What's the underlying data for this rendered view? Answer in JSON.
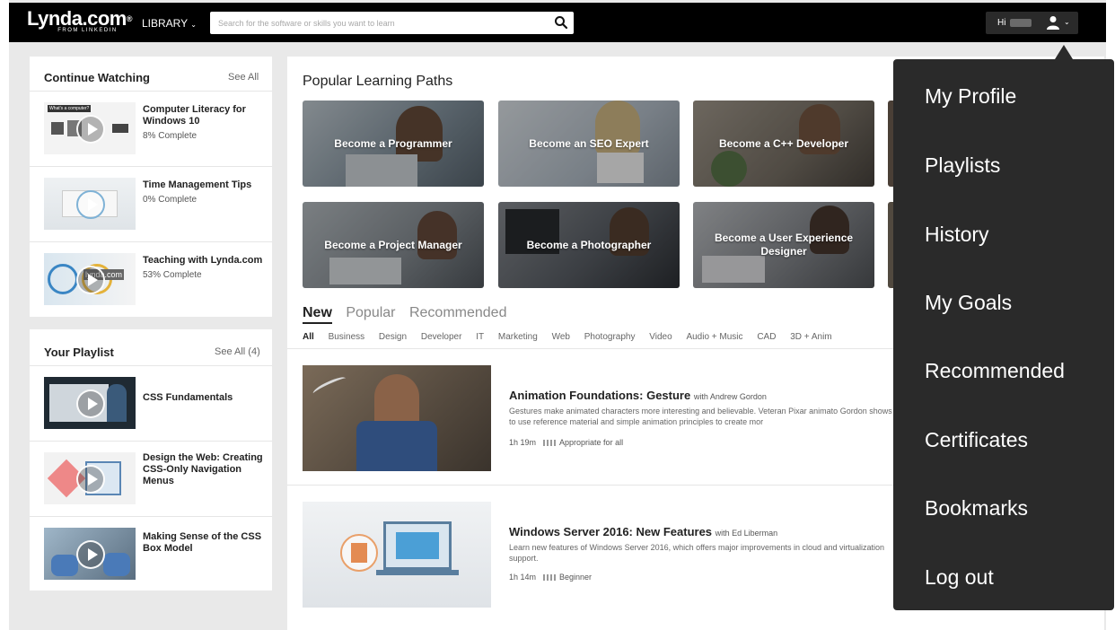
{
  "header": {
    "logo_text": "Lynda.com",
    "logo_sub": "FROM LINKEDIN",
    "library_label": "LIBRARY",
    "search_placeholder": "Search for the software or skills you want to learn",
    "greeting": "Hi"
  },
  "continue_watching": {
    "title": "Continue Watching",
    "see_all": "See All",
    "items": [
      {
        "title": "Computer Literacy for Windows 10",
        "progress": "8% Complete",
        "thumb_text": "What's a computer?"
      },
      {
        "title": "Time Management Tips",
        "progress": "0% Complete"
      },
      {
        "title": "Teaching with Lynda.com",
        "progress": "53% Complete",
        "thumb_text": "lynda.com"
      }
    ]
  },
  "playlist": {
    "title": "Your Playlist",
    "see_all": "See All (4)",
    "items": [
      {
        "title": "CSS Fundamentals"
      },
      {
        "title": "Design the Web: Creating CSS-Only Navigation Menus"
      },
      {
        "title": "Making Sense of the CSS Box Model"
      }
    ]
  },
  "learning_paths": {
    "title": "Popular Learning Paths",
    "paths": [
      {
        "label": "Become a Programmer",
        "color": "#8a9aa6"
      },
      {
        "label": "Become an SEO Expert",
        "color": "#b9c4cf"
      },
      {
        "label": "Become a C++ Developer",
        "color": "#7b7368"
      },
      {
        "label": "Become a Project Manager",
        "color": "#8d949a"
      },
      {
        "label": "Become a Photographer",
        "color": "#5c6168"
      },
      {
        "label": "Become a User Experience Designer",
        "color": "#8a8d92"
      }
    ]
  },
  "tabs": [
    "New",
    "Popular",
    "Recommended"
  ],
  "categories": [
    "All",
    "Business",
    "Design",
    "Developer",
    "IT",
    "Marketing",
    "Web",
    "Photography",
    "Video",
    "Audio + Music",
    "CAD",
    "3D + Anim"
  ],
  "courses": [
    {
      "title": "Animation Foundations: Gesture",
      "author": "with Andrew Gordon",
      "description": "Gestures make animated characters more interesting and believable. Veteran Pixar animato Gordon shows how to use reference material and simple animation principles to create mor",
      "duration": "1h 19m",
      "level": "Appropriate for all"
    },
    {
      "title": "Windows Server 2016: New Features",
      "author": "with Ed Liberman",
      "description": "Learn new features of Windows Server 2016, which offers major improvements in cloud and virtualization support.",
      "duration": "1h 14m",
      "level": "Beginner"
    }
  ],
  "user_menu": {
    "items": [
      "My Profile",
      "Playlists",
      "History",
      "My Goals",
      "Recommended",
      "Certificates",
      "Bookmarks",
      "Log out"
    ]
  },
  "colors": {
    "topbar": "#000000",
    "menu_bg": "#2a2a2a",
    "page_bg": "#e9e9e9"
  }
}
